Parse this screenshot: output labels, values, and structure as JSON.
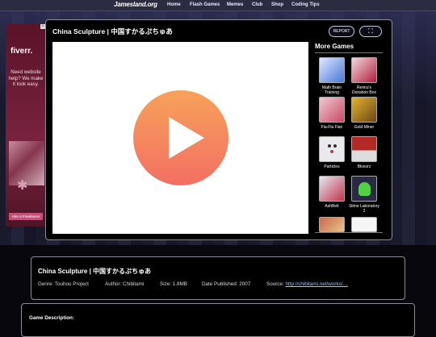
{
  "nav": {
    "brand": "Jamesland.org",
    "items": [
      "Home",
      "Flash Games",
      "Memes",
      "Club",
      "Shop",
      "Coding Tips"
    ]
  },
  "ad": {
    "brand": "fiverr.",
    "copy": "Need website help? We make it look easy.",
    "cta": "Hire a Freelancer",
    "close": "×"
  },
  "game": {
    "title": "China Sculpture | 中国すかるぷちゅあ",
    "button_left_label": "REPORT",
    "button_right_label": "⛶"
  },
  "sidebar": {
    "title": "More Games",
    "items": [
      {
        "label": "Math Brain Training",
        "thumb_color": "#dfe9ff",
        "thumb_accent": "#4a77d8"
      },
      {
        "label": "Reimu's Donation Box",
        "thumb_color": "#f2d8df",
        "thumb_accent": "#b21e3c"
      },
      {
        "label": "Fla-Fla Flan",
        "thumb_color": "#f1c9d2",
        "thumb_accent": "#c84a68"
      },
      {
        "label": "Gold Miner",
        "thumb_color": "#e5b233",
        "thumb_accent": "#6a4814"
      },
      {
        "label": "Particles",
        "thumb_color": "#e9e9ee",
        "thumb_accent": "#2f2f36"
      },
      {
        "label": "Bloxorz",
        "thumb_color": "#b32a24",
        "thumb_accent": "#f0f0f0"
      },
      {
        "label": "AshBelt",
        "thumb_color": "#e6e8f4",
        "thumb_accent": "#c2344a"
      },
      {
        "label": "Slime Laboratory 2",
        "thumb_color": "#2b2a45",
        "thumb_accent": "#52d243"
      },
      {
        "label": "",
        "thumb_color": "#c96a4d",
        "thumb_accent": "#e7c28c"
      },
      {
        "label": "",
        "thumb_color": "#f5f5f5",
        "thumb_accent": "#333333"
      }
    ]
  },
  "info": {
    "title": "China Sculpture | 中国すかるぷちゅあ",
    "genre": "Genre:  Touhou Project",
    "author": "Author:  Chibitami",
    "size": "Size:  1.8MB",
    "date": "Date Published:  2007",
    "source_label": "Source:",
    "source_link": "http://chibitami.net/works/…"
  },
  "description": {
    "title": "Game Description:"
  },
  "colors": {
    "play_top": "#f6a25a",
    "play_bottom": "#f46f63",
    "panel_border": "#8a8a9a"
  }
}
